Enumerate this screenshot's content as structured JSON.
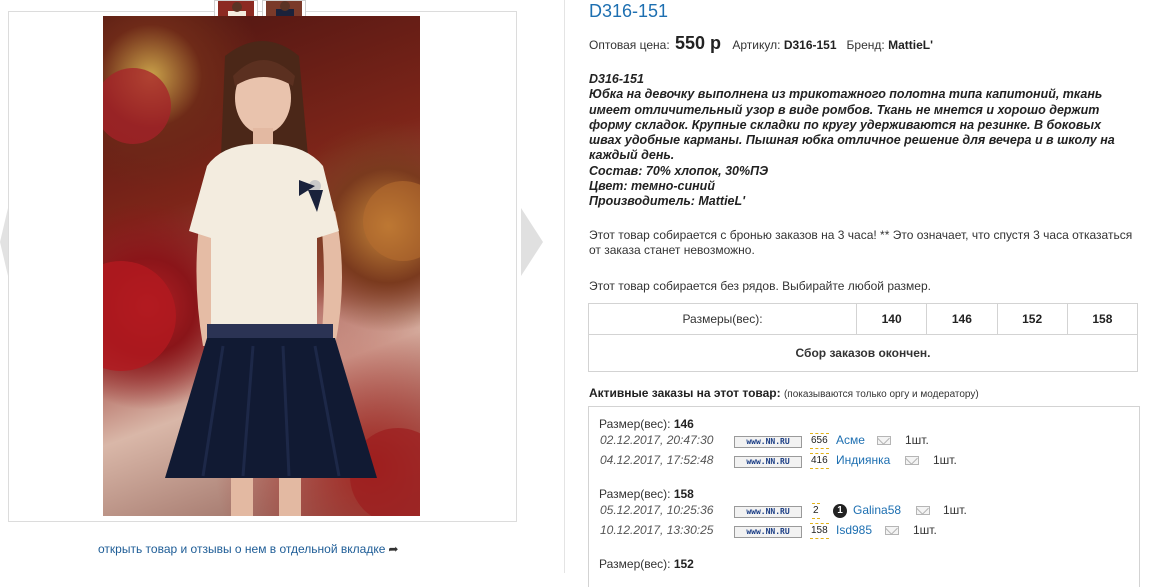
{
  "product": {
    "title": "D316-151",
    "price_label": "Оптовая цена:",
    "price": "550 р",
    "article_label": "Артикул:",
    "article": "D316-151",
    "brand_label": "Бренд:",
    "brand": "MattieL'"
  },
  "description": [
    "D316-151",
    "Юбка на девочку выполнена из трикотажного полотна типа капитоний, ткань",
    "имеет отличительный узор в виде ромбов. Ткань не мнется и хорошо держит",
    "форму складок. Крупные складки по кругу удерживаются на резинке. В боковых",
    "швах удобные карманы. Пышная юбка отличное решение для вечера и в школу на",
    "каждый день.",
    "Состав: 70% хлопок, 30%ПЭ",
    "Цвет: темно-синий",
    "Производитель: MattieL'"
  ],
  "notes": {
    "reserve": "Этот товар собирается с бронью заказов на 3 часа! ** Это означает, что спустя 3 часа отказаться от заказа станет невозможно.",
    "no_rows": "Этот товар собирается без рядов. Выбирайте любой размер."
  },
  "sizes_table": {
    "label": "Размеры(вес):",
    "sizes": [
      "140",
      "146",
      "152",
      "158"
    ],
    "status": "Сбор заказов окончен."
  },
  "orders": {
    "heading": "Активные заказы на этот товар:",
    "heading_note": "(показываются только оргу и модератору)",
    "group_label": "Размер(вес):",
    "groups": [
      {
        "size": "146",
        "rows": [
          {
            "date": "02.12.2017, 20:47:30",
            "logo": "www.NN.RU",
            "rating": "656",
            "user": "Асме",
            "qty": "1шт."
          },
          {
            "date": "04.12.2017, 17:52:48",
            "logo": "www.NN.RU",
            "rating": "416",
            "user": "Индиянка",
            "qty": "1шт."
          }
        ]
      },
      {
        "size": "158",
        "rows": [
          {
            "date": "05.12.2017, 10:25:36",
            "logo": "www.NN.RU",
            "rating": "2",
            "badge": "1",
            "user": "Galina58",
            "qty": "1шт."
          },
          {
            "date": "10.12.2017, 13:30:25",
            "logo": "www.NN.RU",
            "rating": "158",
            "user": "Isd985",
            "qty": "1шт."
          }
        ]
      },
      {
        "size": "152",
        "rows": []
      }
    ]
  },
  "gallery": {
    "open_link": "открыть товар и отзывы о нем в отдельной вкладке"
  },
  "colors": {
    "link": "#1d6fb1",
    "skirt": "#111a33",
    "blouse": "#f3ecdf",
    "background_red": "#8a1519"
  }
}
